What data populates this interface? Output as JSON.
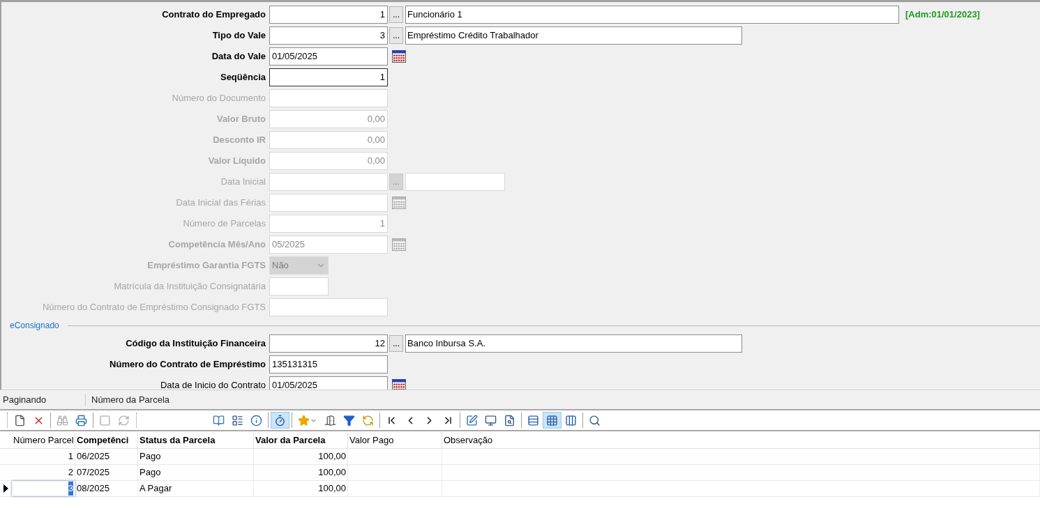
{
  "form": {
    "rows": [
      {
        "label": "Contrato do Empregado",
        "label_bold": true,
        "kind": "lookup",
        "disabled": false,
        "focused": false,
        "value": "1",
        "button_text": "...",
        "description": "Funcionário 1",
        "badge": "[Adm:01/01/2023]"
      },
      {
        "label": "Tipo do Vale",
        "label_bold": true,
        "kind": "lookup",
        "disabled": false,
        "focused": false,
        "value": "3",
        "button_text": "...",
        "description": "Empréstimo Crédito Trabalhador"
      },
      {
        "label": "Data do Vale",
        "label_bold": true,
        "kind": "date",
        "disabled": false,
        "focused": false,
        "value": "01/05/2025"
      },
      {
        "label": "Seqüência",
        "label_bold": true,
        "kind": "number",
        "disabled": false,
        "focused": true,
        "value": "1"
      },
      {
        "label": "Número do Documento",
        "label_bold": false,
        "kind": "text",
        "disabled": true,
        "focused": false
      },
      {
        "label": "Valor Bruto",
        "label_bold": true,
        "kind": "number",
        "disabled": true,
        "focused": false,
        "value": "0,00"
      },
      {
        "label": "Desconto IR",
        "label_bold": true,
        "kind": "number",
        "disabled": true,
        "focused": false,
        "value": "0,00"
      },
      {
        "label": "Valor Líquido",
        "label_bold": true,
        "kind": "number",
        "disabled": true,
        "focused": false,
        "value": "0,00"
      },
      {
        "label": "Data Inicial",
        "label_bold": false,
        "kind": "lookup",
        "disabled": true,
        "focused": false,
        "button_text": "..."
      },
      {
        "label": "Data Inicial das Férias",
        "label_bold": false,
        "kind": "date",
        "disabled": true,
        "focused": false
      },
      {
        "label": "Número de Parcelas",
        "label_bold": false,
        "kind": "number",
        "disabled": true,
        "focused": false,
        "value": "1"
      },
      {
        "label": "Competência Mês/Ano",
        "label_bold": true,
        "kind": "date",
        "disabled": true,
        "focused": false,
        "value": "05/2025"
      },
      {
        "label": "Empréstimo Garantia FGTS",
        "label_bold": true,
        "kind": "select",
        "disabled": true,
        "focused": false,
        "value": "Não"
      },
      {
        "label": "Matrícula da Instituição Consignatária",
        "label_bold": false,
        "kind": "short_text",
        "disabled": true,
        "focused": false
      },
      {
        "label": "Número do Contrato de Empréstimo Consignado FGTS",
        "label_bold": false,
        "kind": "text",
        "disabled": true,
        "focused": false
      },
      {
        "kind": "section",
        "label": "eConsignado"
      },
      {
        "label": "Código da Instituição Financeira",
        "label_bold": true,
        "kind": "lookup",
        "disabled": false,
        "focused": false,
        "value": "12",
        "button_text": "...",
        "description": "Banco Inbursa S.A."
      },
      {
        "label": "Número do Contrato de Empréstimo",
        "label_bold": true,
        "kind": "text",
        "disabled": false,
        "focused": false,
        "value": "135131315"
      },
      {
        "label": "Data de Inicio do Contrato",
        "label_bold": false,
        "kind": "date",
        "disabled": false,
        "focused": false,
        "value": "01/05/2025"
      }
    ]
  },
  "paging_bar": {
    "mode": "Paginando",
    "field": "Número da Parcela"
  },
  "toolbar": [
    [
      {
        "kind": "new",
        "disabled": false,
        "selected": false
      },
      {
        "kind": "delete",
        "disabled": false,
        "selected": false
      }
    ],
    [
      {
        "kind": "find",
        "disabled": true,
        "selected": false
      },
      {
        "kind": "print",
        "disabled": false,
        "selected": false
      }
    ],
    [
      {
        "kind": "save",
        "disabled": true,
        "selected": false
      },
      {
        "kind": "refresh",
        "disabled": true,
        "selected": false
      }
    ],
    [
      {
        "kind": "help",
        "disabled": false,
        "selected": false
      },
      {
        "kind": "form",
        "disabled": false,
        "selected": false
      },
      {
        "kind": "info",
        "disabled": false,
        "selected": false
      }
    ],
    [
      {
        "kind": "timer",
        "disabled": false,
        "selected": true
      }
    ],
    [
      {
        "kind": "favorite",
        "disabled": false,
        "selected": false
      },
      {
        "kind": "exit",
        "disabled": false,
        "selected": false
      },
      {
        "kind": "filter",
        "disabled": false,
        "selected": false
      },
      {
        "kind": "sync",
        "disabled": false,
        "selected": false
      }
    ],
    [
      {
        "kind": "first",
        "disabled": false,
        "selected": false
      },
      {
        "kind": "prev",
        "disabled": false,
        "selected": false
      },
      {
        "kind": "next",
        "disabled": false,
        "selected": false
      },
      {
        "kind": "last",
        "disabled": false,
        "selected": false
      }
    ],
    [
      {
        "kind": "edit",
        "disabled": false,
        "selected": false
      },
      {
        "kind": "report",
        "disabled": false,
        "selected": false
      },
      {
        "kind": "report_search",
        "disabled": false,
        "selected": false
      }
    ],
    [
      {
        "kind": "grid_a",
        "disabled": false,
        "selected": false
      },
      {
        "kind": "grid_b",
        "disabled": false,
        "selected": true
      },
      {
        "kind": "grid_c",
        "disabled": false,
        "selected": false
      }
    ],
    [
      {
        "kind": "preview",
        "disabled": false,
        "selected": false
      }
    ]
  ],
  "grid": {
    "columns": [
      {
        "label": "Número Parcel",
        "bold": false
      },
      {
        "label": "Competênci",
        "bold": true
      },
      {
        "label": "Status da Parcela",
        "bold": true
      },
      {
        "label": "Valor da Parcela",
        "bold": true
      },
      {
        "label": "Valor Pago",
        "bold": false
      },
      {
        "label": "Observação",
        "bold": false
      }
    ],
    "rows": [
      {
        "selected": false,
        "cells": [
          "1",
          "06/2025",
          "Pago",
          "100,00"
        ]
      },
      {
        "selected": false,
        "cells": [
          "2",
          "07/2025",
          "Pago",
          "100,00"
        ]
      },
      {
        "selected": true,
        "cells": [
          "3",
          "08/2025",
          "A Pagar",
          "100,00"
        ]
      }
    ]
  }
}
